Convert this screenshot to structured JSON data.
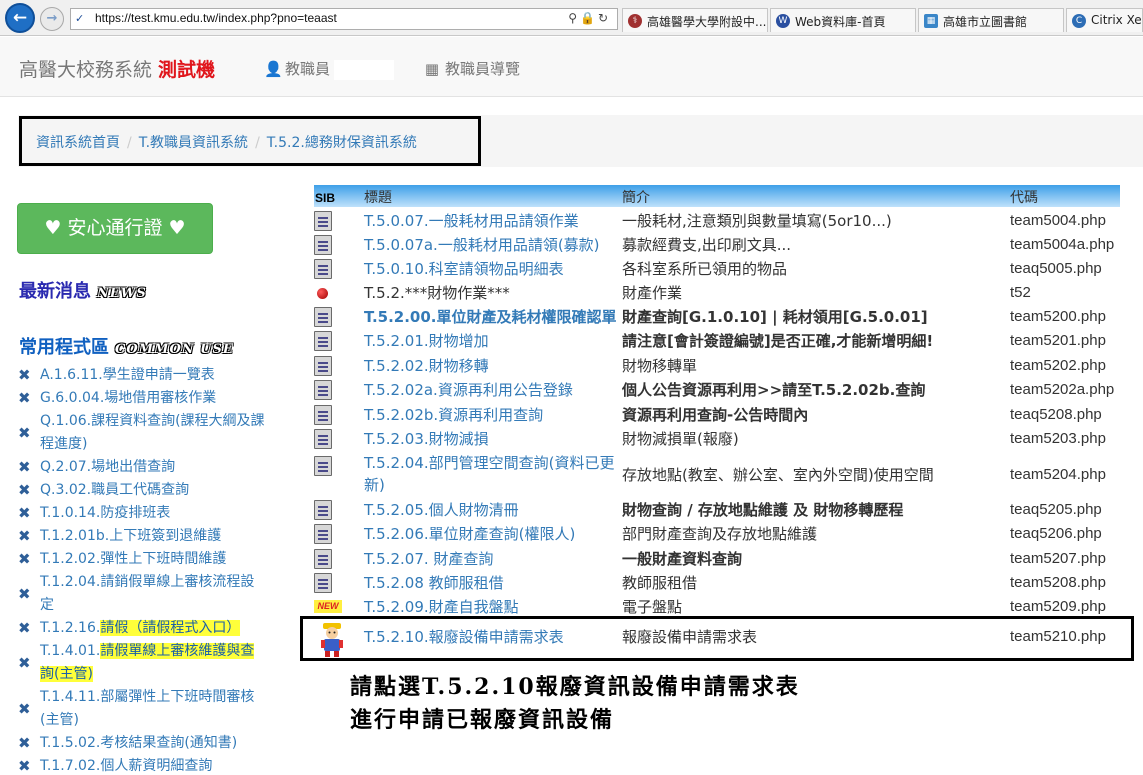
{
  "browser": {
    "url": "https://test.kmu.edu.tw/index.php?pno=teaast",
    "tabs": [
      {
        "label": "高雄醫學大學附設中..."
      },
      {
        "label": "Web資料庫-首頁"
      },
      {
        "label": "高雄市立圖書館"
      },
      {
        "label": "Citrix Xen"
      }
    ]
  },
  "navbar": {
    "brand": "高醫大校務系統",
    "brand_badge": "測試機",
    "user_label": "教職員",
    "guide_label": "教職員導覽"
  },
  "breadcrumb": [
    "資訊系統首頁",
    "T.教職員資訊系統",
    "T.5.2.總務財保資訊系統"
  ],
  "sidebar": {
    "pass_button": "♥ 安心通行證 ♥",
    "news_title": "最新消息",
    "news_deco": "NEWS",
    "common_title": "常用程式區",
    "common_deco": "COMMON USE",
    "items": [
      {
        "code": "A.1.6.11.",
        "label": "學生證申請一覽表"
      },
      {
        "code": "G.6.0.04.",
        "label": "場地借用審核作業"
      },
      {
        "code": "Q.1.06.",
        "label": "課程資料查詢(課程大綱及課程進度)"
      },
      {
        "code": "Q.2.07.",
        "label": "場地出借查詢"
      },
      {
        "code": "Q.3.02.",
        "label": "職員工代碼查詢"
      },
      {
        "code": "T.1.0.14.",
        "label": "防疫排班表"
      },
      {
        "code": "T.1.2.01b.",
        "label": "上下班簽到退維護"
      },
      {
        "code": "T.1.2.02.",
        "label": "彈性上下班時間維護"
      },
      {
        "code": "T.1.2.04.",
        "label": "請銷假單線上審核流程設定"
      },
      {
        "code": "T.1.2.16.",
        "label": "請假（請假程式入口）"
      },
      {
        "code": "T.1.4.01.",
        "label": "請假單線上審核維護與查詢(主管)"
      },
      {
        "code": "T.1.4.11.",
        "label": "部屬彈性上下班時間審核(主管)"
      },
      {
        "code": "T.1.5.02.",
        "label": "考核結果查詢(通知書)"
      },
      {
        "code": "T.1.7.02.",
        "label": "個人薪資明細查詢"
      }
    ]
  },
  "table": {
    "sib_label": "SIB",
    "headers": {
      "title": "標題",
      "desc": "簡介",
      "code": "代碼"
    },
    "rows": [
      {
        "icon": "document-icon",
        "title": "T.5.0.07.一般耗材用品請領作業",
        "desc": "一般耗材,注意類別與數量填寫(5or10...)",
        "code": "team5004.php"
      },
      {
        "icon": "document-icon",
        "title": "T.5.0.07a.一般耗材用品請領(募款)",
        "desc": "募款經費支,出印刷文具...",
        "code": "team5004a.php"
      },
      {
        "icon": "document-icon",
        "title": "T.5.0.10.科室請領物品明細表",
        "desc": "各科室系所已領用的物品",
        "code": "teaq5005.php"
      },
      {
        "icon": "red-ball-icon",
        "title": "T.5.2.***財物作業***",
        "desc": "財產作業",
        "code": "t52"
      },
      {
        "icon": "document-icon",
        "title": "T.5.2.00.單位財產及耗材權限確認單",
        "desc": "財產查詢[G.1.0.10] | 耗材領用[G.5.0.01]",
        "code": "team5200.php"
      },
      {
        "icon": "document-icon",
        "title": "T.5.2.01.財物增加",
        "desc": "請注意[會計簽證編號]是否正確,才能新增明細!",
        "code": "team5201.php"
      },
      {
        "icon": "document-icon",
        "title": "T.5.2.02.財物移轉",
        "desc": "財物移轉單",
        "code": "team5202.php"
      },
      {
        "icon": "document-icon",
        "title": "T.5.2.02a.資源再利用公告登錄",
        "desc": "個人公告資源再利用>>請至T.5.2.02b.查詢",
        "code": "team5202a.php"
      },
      {
        "icon": "document-icon",
        "title": "T.5.2.02b.資源再利用查詢",
        "desc": "資源再利用查詢-公告時間內",
        "code": "teaq5208.php"
      },
      {
        "icon": "document-icon",
        "title": "T.5.2.03.財物減損",
        "desc": "財物減損單(報廢)",
        "code": "team5203.php"
      },
      {
        "icon": "document-icon",
        "title": "T.5.2.04.部門管理空間查詢(資料已更新)",
        "desc": "存放地點(教室、辦公室、室內外空間)使用空間",
        "code": "team5204.php"
      },
      {
        "icon": "document-icon",
        "title": "T.5.2.05.個人財物清冊",
        "desc": "財物查詢 / 存放地點維護 及 財物移轉歷程",
        "code": "teaq5205.php"
      },
      {
        "icon": "document-icon",
        "title": "T.5.2.06.單位財產查詢(權限人)",
        "desc": "部門財產查詢及存放地點維護",
        "code": "teaq5206.php"
      },
      {
        "icon": "document-icon",
        "title": "T.5.2.07. 財產查詢",
        "desc": "一般財產資料查詢",
        "code": "team5207.php"
      },
      {
        "icon": "document-icon",
        "title": "T.5.2.08 教師服租借",
        "desc": "教師服租借",
        "code": "team5208.php"
      },
      {
        "icon": "new-badge-icon",
        "title": "T.5.2.09.財產自我盤點",
        "desc": "電子盤點",
        "code": "team5209.php"
      },
      {
        "icon": "worker-figure-icon",
        "title": "T.5.2.10.報廢設備申請需求表",
        "desc": "報廢設備申請需求表",
        "code": "team5210.php"
      }
    ]
  },
  "instruction": [
    "請點選T.5.2.10報廢資訊設備申請需求表",
    "進行申請已報廢資訊設備"
  ],
  "icons": {
    "back": "←",
    "forward": "→",
    "user": "👤",
    "grid": "▦",
    "close": "✖",
    "new_badge": "NEW"
  }
}
